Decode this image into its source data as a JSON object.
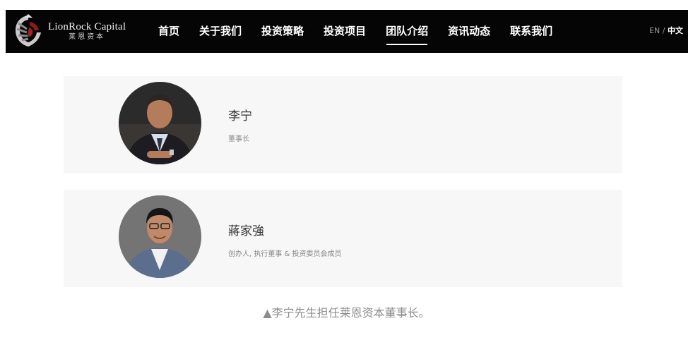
{
  "header": {
    "logo": {
      "name_en": "LionRock Capital",
      "name_cn": "莱恩资本"
    },
    "nav": [
      {
        "label": "首页"
      },
      {
        "label": "关于我们"
      },
      {
        "label": "投资策略"
      },
      {
        "label": "投资项目"
      },
      {
        "label": "团队介绍",
        "active": true
      },
      {
        "label": "资讯动态"
      },
      {
        "label": "联系我们"
      }
    ],
    "lang": {
      "en": "EN",
      "separator": " / ",
      "cn": "中文"
    }
  },
  "team": [
    {
      "name": "李宁",
      "title": "董事长"
    },
    {
      "name": "蔣家強",
      "title": "创办人, 执行董事 & 投资委员会成员"
    }
  ],
  "caption": "▲李宁先生担任莱恩资本董事长。",
  "colors": {
    "header_bg": "#050505",
    "card_bg": "#f7f7f7",
    "caption": "#8c8c8c"
  }
}
